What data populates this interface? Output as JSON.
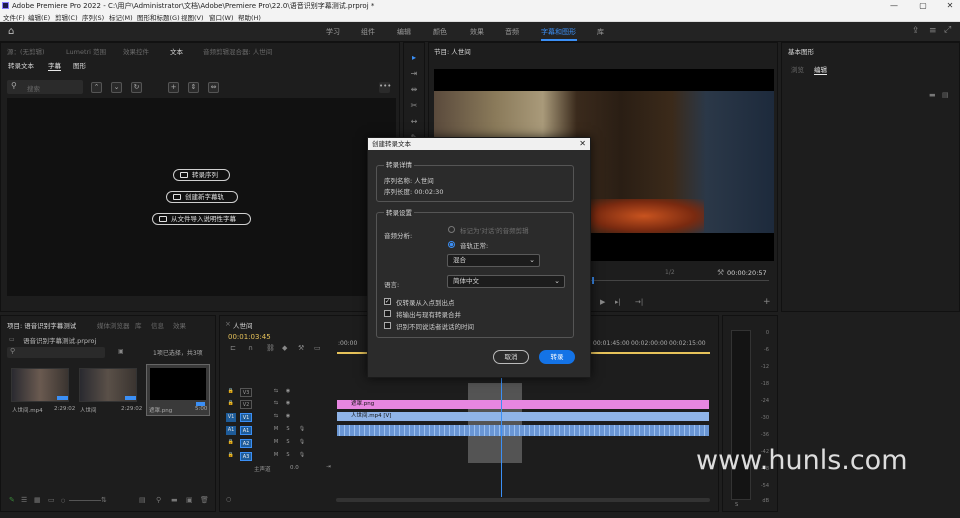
{
  "title_bar": {
    "title": "Adobe Premiere Pro 2022 - C:\\用户\\Administrator\\文档\\Adobe\\Premiere Pro\\22.0\\语音识别字幕测试.prproj *"
  },
  "window_controls": {
    "minimize": "—",
    "maximize": "▢",
    "close": "✕"
  },
  "menu": [
    "文件(F)",
    "编辑(E)",
    "剪辑(C)",
    "序列(S)",
    "标记(M)",
    "图形和标题(G)",
    "视图(V)",
    "窗口(W)",
    "帮助(H)"
  ],
  "workspaces": [
    "学习",
    "组件",
    "编辑",
    "颜色",
    "效果",
    "音频",
    "字幕和图形",
    "库"
  ],
  "workspace_active": "字幕和图形",
  "top_left_tabs": [
    "源：(无剪辑)",
    "Lumetri 范围",
    "效果控件",
    "文本",
    "音频剪辑混合器: 人世间"
  ],
  "text_panel": {
    "subtabs": [
      "转录文本",
      "字幕",
      "图形"
    ],
    "search_placeholder": "搜索",
    "buttons": [
      "转录序列",
      "创建新字幕轨",
      "从文件导入说明性字幕"
    ],
    "more": "•••"
  },
  "program_tab": "节目: 人世间",
  "program_timecode": "00:00:20:57",
  "program_fraction": "1/2",
  "right_panel": {
    "title": "基本图形",
    "tabs": [
      "浏览",
      "编辑"
    ]
  },
  "project_panel": {
    "tabs": [
      "项目: 语音识别字幕测试",
      "媒体浏览器",
      "库",
      "信息",
      "效果"
    ],
    "file": "语音识别字幕测试.prproj",
    "selection": "1项已选择，共3项",
    "items": [
      {
        "name": "人世间.mp4",
        "dur": "2:29:02"
      },
      {
        "name": "人世间",
        "dur": "2:29:02"
      },
      {
        "name": "遮罩.png",
        "dur": "5:00"
      }
    ]
  },
  "timeline": {
    "tab": "人世间",
    "timecode": "00:01:03:45",
    "ruler": [
      ":00:00",
      "00:01:45:00",
      "00:02:00:00",
      "00:02:15:00"
    ],
    "tracks": [
      "V3",
      "V2",
      "V1",
      "A1",
      "A2",
      "A3"
    ],
    "master": "主声道",
    "master_value": "0.0",
    "source_patch_v": "V1",
    "source_patch_a": "A1",
    "clips": {
      "v2": "遮罩.png",
      "v1": "人世间.mp4 [V]"
    }
  },
  "meter": {
    "labels": [
      "0",
      "-6",
      "-12",
      "-18",
      "-24",
      "-30",
      "-36",
      "-42",
      "-48",
      "-54",
      "dB"
    ],
    "solo": "S"
  },
  "dialog": {
    "title": "创建转录文本",
    "close": "✕",
    "details_label": "转录详情",
    "seq_name": "序列名称: 人世间",
    "seq_length": "序列长度: 00:02:30",
    "settings_label": "转录设置",
    "audio_analysis": "音频分析:",
    "radio1": "标记为'对话'的音频剪辑",
    "radio2": "音轨正常:",
    "mix": "混合",
    "language_label": "语言:",
    "language": "简体中文",
    "cb1": "仅转录从入点到出点",
    "cb2": "将输出与现有转录合并",
    "cb3": "识别不同说话者说话的时间",
    "cancel": "取消",
    "transcribe": "转录"
  },
  "watermark": "www.hunls.com",
  "colors": {
    "accent": "#3b8ff5",
    "v2_clip": "#e786e0",
    "v1_clip": "#8fb4e8",
    "audio_clip": "#6a96d4"
  }
}
